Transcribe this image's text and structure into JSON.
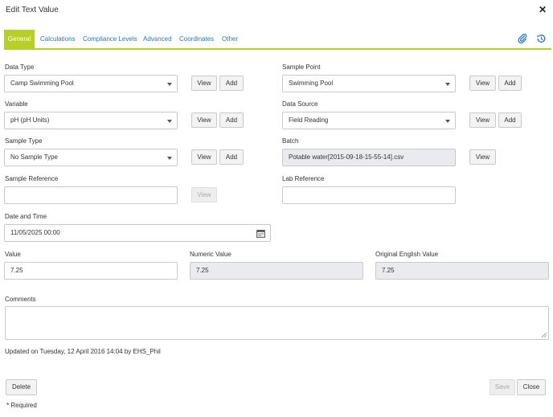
{
  "dialog": {
    "title": "Edit Text Value",
    "close_glyph": "✕"
  },
  "tabs": [
    {
      "label": "General",
      "active": true
    },
    {
      "label": "Calculations"
    },
    {
      "label": "Compliance Levels"
    },
    {
      "label": "Advanced"
    },
    {
      "label": "Coordinates"
    },
    {
      "label": "Other"
    }
  ],
  "tab_icons": [
    "paperclip-icon",
    "history-icon"
  ],
  "colors": {
    "accent": "#b7cf28",
    "link": "#2778c4",
    "readonly_bg": "#e9ebee"
  },
  "buttons": {
    "view": "View",
    "add": "Add"
  },
  "fields": {
    "data_type": {
      "label": "Data Type",
      "value": "Camp Swimming Pool"
    },
    "sample_point": {
      "label": "Sample Point",
      "value": "Swimming Pool"
    },
    "variable": {
      "label": "Variable",
      "value": "pH (pH Units)"
    },
    "data_source": {
      "label": "Data Source",
      "value": "Field Reading"
    },
    "sample_type": {
      "label": "Sample Type",
      "value": "No Sample Type"
    },
    "batch": {
      "label": "Batch",
      "value": "Potable water[2015-09-18-15-55-14].csv"
    },
    "sample_reference": {
      "label": "Sample Reference",
      "value": ""
    },
    "lab_reference": {
      "label": "Lab Reference",
      "value": ""
    },
    "date_time": {
      "label": "Date and Time",
      "value": "11/05/2025 00:00"
    },
    "value": {
      "label": "Value",
      "value": "7.25"
    },
    "numeric_value": {
      "label": "Numeric Value",
      "value": "7.25"
    },
    "original_english_value": {
      "label": "Original English Value",
      "value": "7.25"
    },
    "comments": {
      "label": "Comments",
      "value": ""
    }
  },
  "updated_text": "Updated on Tuesday, 12 April 2016 14:04 by EHS_Phil",
  "footer": {
    "delete": "Delete",
    "save": "Save",
    "close": "Close",
    "required_note": "* Required"
  }
}
